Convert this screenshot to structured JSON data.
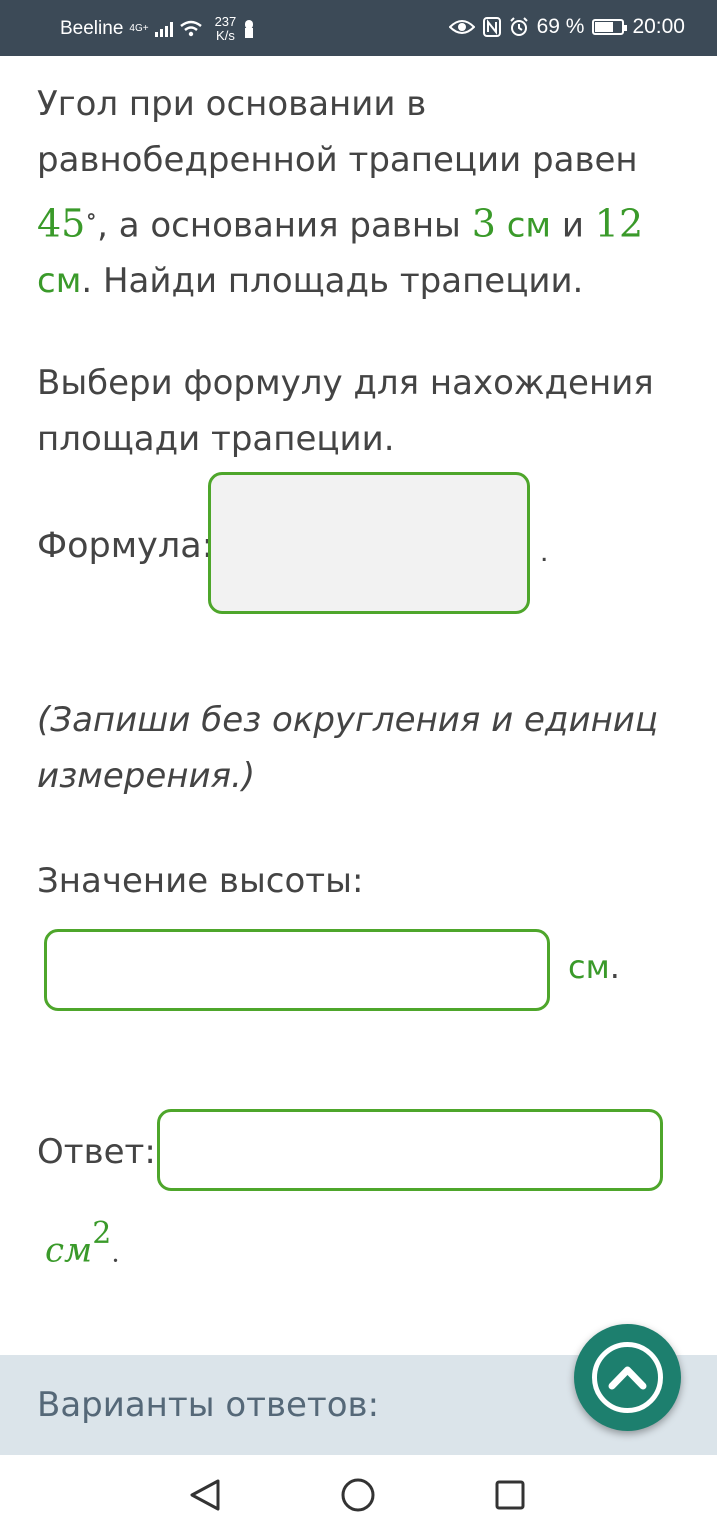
{
  "status_bar": {
    "carrier": "Beeline",
    "network": "4G+",
    "speed_value": "237",
    "speed_unit": "K/s",
    "battery": "69 %",
    "battery_level": 0.69,
    "time": "20:00"
  },
  "problem": {
    "t1": "Угол при основании в равнобедренной трапеции равен ",
    "angle": "45",
    "degree": "∘",
    "t2": ", а основания равны ",
    "base1": "3",
    "unit_cm_a": "см",
    "t3": " и ",
    "base2": "12",
    "unit_cm_b": "см",
    "t4": ". Найди площадь трапеции."
  },
  "instruction": "Выбери формулу для нахождения площади трапеции.",
  "formula": {
    "label": "Формула:",
    "dot": "."
  },
  "note": "(Запиши без округления и единиц измерения.)",
  "height": {
    "label": "Значение высоты:",
    "unit": "см",
    "dot": "."
  },
  "answer": {
    "label": "Ответ:",
    "unit": "см",
    "exponent": "2",
    "dot": "."
  },
  "variants_label": "Варианты ответов:",
  "colors": {
    "accent": "#4ea62b",
    "fab": "#1d7f6e",
    "status_bar": "#3c4a57"
  },
  "icons": {
    "fab": "chevron-up-icon",
    "nav": [
      "back-triangle-icon",
      "home-circle-icon",
      "recents-square-icon"
    ]
  }
}
